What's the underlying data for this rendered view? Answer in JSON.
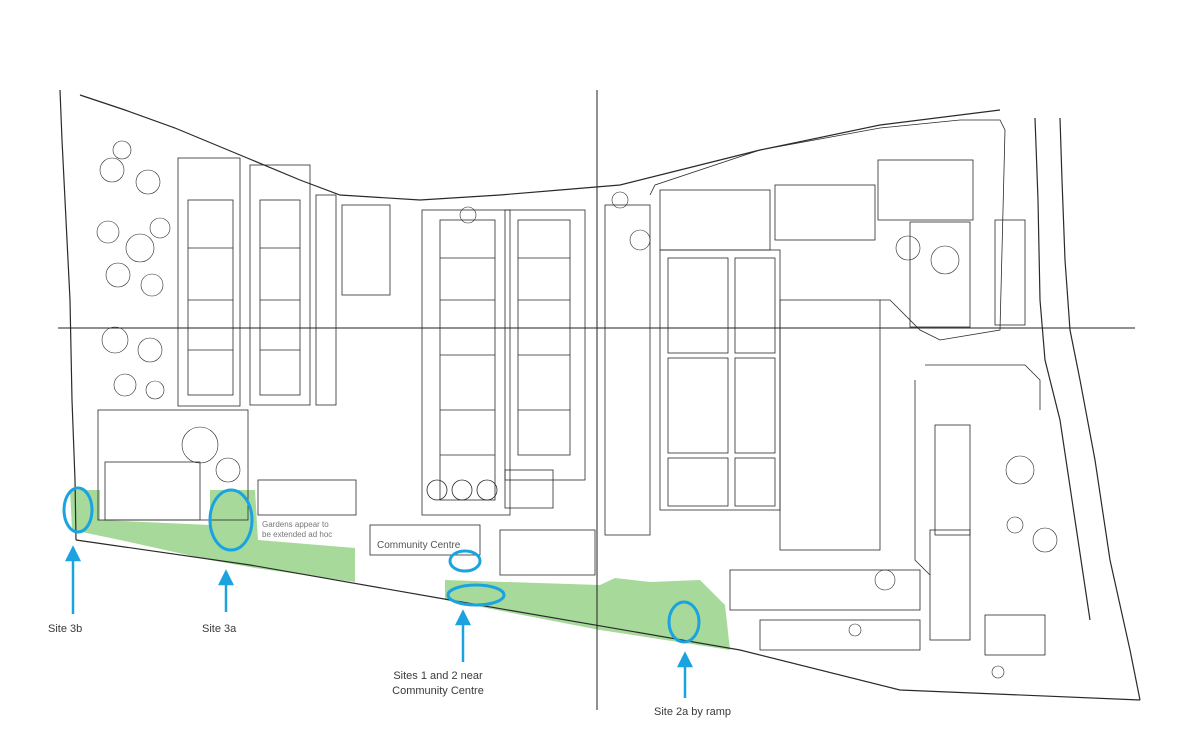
{
  "map": {
    "callouts": {
      "site_3b": "Site 3b",
      "site_3a": "Site 3a",
      "sites_1_2_line1": "Sites 1 and 2 near",
      "sites_1_2_line2": "Community Centre",
      "site_2a": "Site 2a by ramp"
    },
    "annotations": {
      "community_centre": "Community Centre",
      "gardens_note_line1": "Gardens appear to",
      "gardens_note_line2": "be extended ad hoc"
    },
    "colors": {
      "garden_fill": "#a6d99a",
      "highlight_ring": "#1aa3e0",
      "arrow": "#1aa3e0",
      "linework": "#2a2a2a"
    }
  }
}
